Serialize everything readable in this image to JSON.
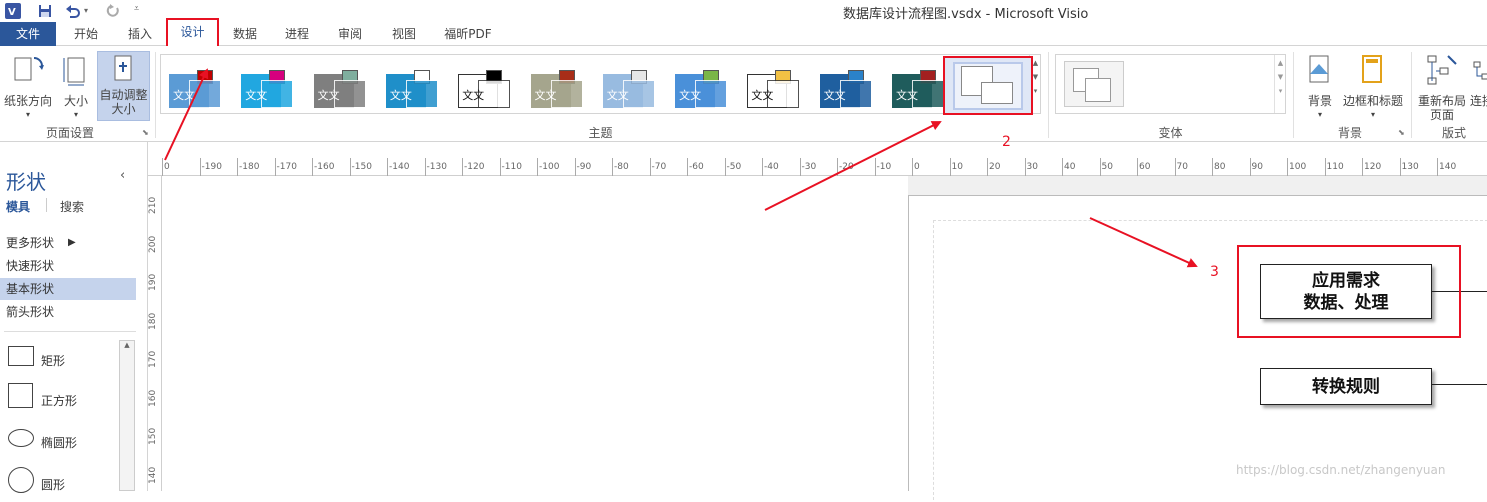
{
  "window": {
    "title": "数据库设计流程图.vsdx - Microsoft Visio"
  },
  "qat": {
    "app_icon": "visio-icon",
    "save_icon": "save-icon",
    "undo_icon": "undo-icon",
    "redo_icon": "redo-icon"
  },
  "tabs": [
    {
      "label": "文件",
      "active": false
    },
    {
      "label": "开始",
      "active": false
    },
    {
      "label": "插入",
      "active": false
    },
    {
      "label": "设计",
      "active": true
    },
    {
      "label": "数据",
      "active": false
    },
    {
      "label": "进程",
      "active": false
    },
    {
      "label": "审阅",
      "active": false
    },
    {
      "label": "视图",
      "active": false
    },
    {
      "label": "福昕PDF",
      "active": false
    }
  ],
  "ribbon": {
    "page_setup": {
      "group_label": "页面设置",
      "orientation_label": "纸张方向",
      "size_label": "大小",
      "autosize_label_1": "自动调整",
      "autosize_label_2": "大小"
    },
    "themes": {
      "group_label": "主题",
      "sample_text": "文文",
      "items": [
        {
          "bg": "#5b9bd5",
          "accent": "#c00000"
        },
        {
          "bg": "#21a7e0",
          "accent": "#d6007e"
        },
        {
          "bg": "#7f7f7f",
          "accent": "#7fae9e"
        },
        {
          "bg": "#1f8fc9",
          "accent": "#ffffff"
        },
        {
          "bg": "#ffffff",
          "accent": "#000000"
        },
        {
          "bg": "#a5a58d",
          "accent": "#a82d18"
        },
        {
          "bg": "#98bbe0",
          "accent": "#e6e6e6"
        },
        {
          "bg": "#4a90d9",
          "accent": "#7ab648"
        },
        {
          "bg": "#ffffff",
          "accent": "#f2c144"
        },
        {
          "bg": "#1f5f9f",
          "accent": "#2b82c9"
        },
        {
          "bg": "#1f5c5c",
          "accent": "#a32020"
        },
        {
          "bg": "#f2f2f2",
          "accent": "#d9d9d9"
        }
      ]
    },
    "variants": {
      "group_label": "变体"
    },
    "backgrounds": {
      "group_label": "背景",
      "background_label": "背景",
      "borders_label": "边框和标题"
    },
    "layout": {
      "group_label": "版式",
      "relayout_label_1": "重新布局",
      "relayout_label_2": "页面",
      "connectors_label": "连接"
    }
  },
  "shapes_pane": {
    "title": "形状",
    "collapse_icon": "chevron-left-icon",
    "tab_stencils": "模具",
    "tab_search": "搜索",
    "more_shapes": "更多形状",
    "stencil_list": [
      "快速形状",
      "基本形状",
      "箭头形状"
    ],
    "selected_stencil": "基本形状",
    "shapes": [
      {
        "name": "矩形",
        "shape": "rectangle"
      },
      {
        "name": "正方形",
        "shape": "square"
      },
      {
        "name": "椭圆形",
        "shape": "ellipse"
      },
      {
        "name": "圆形",
        "shape": "circle"
      }
    ]
  },
  "rulers": {
    "horizontal_ticks": [
      "0",
      "-190",
      "-180",
      "-170",
      "-160",
      "-150",
      "-140",
      "-130",
      "-120",
      "-110",
      "-100",
      "-90",
      "-80",
      "-70",
      "-60",
      "-50",
      "-40",
      "-30",
      "-20",
      "-10",
      "0",
      "10",
      "20",
      "30",
      "40",
      "50",
      "60",
      "70",
      "80",
      "90",
      "100",
      "110",
      "120",
      "130",
      "140"
    ],
    "vertical_ticks": [
      "210",
      "200",
      "190",
      "180",
      "170",
      "160",
      "150",
      "140"
    ]
  },
  "diagram": {
    "boxes": [
      {
        "text": "应用需求\n数据、处理"
      },
      {
        "text": "转换规则"
      }
    ]
  },
  "annotations": {
    "step2": "2",
    "step3": "3",
    "highlight_color": "#e81123"
  },
  "watermark": "https://blog.csdn.net/zhangenyuan"
}
